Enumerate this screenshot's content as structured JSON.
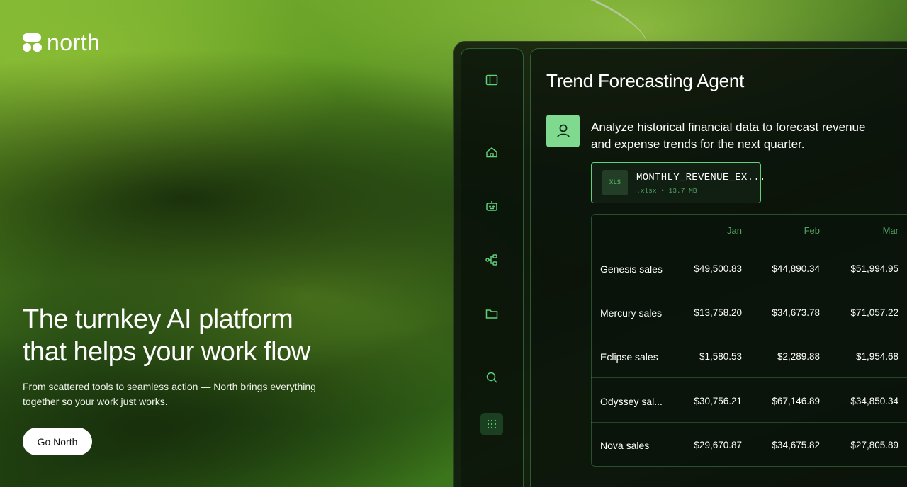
{
  "brand": {
    "name": "north"
  },
  "hero": {
    "headline_line1": "The turnkey AI platform",
    "headline_line2": "that helps your work flow",
    "subtext": "From scattered tools to seamless action — North brings everything together so your work just works.",
    "cta_label": "Go North"
  },
  "sidebar": {
    "icons": [
      "sidebar-toggle-icon",
      "home-icon",
      "bot-icon",
      "workflow-icon",
      "folder-icon",
      "search-icon",
      "apps-grid-icon"
    ]
  },
  "agent": {
    "title": "Trend Forecasting Agent",
    "prompt": "Analyze historical financial data to forecast revenue and expense trends for the next quarter.",
    "file": {
      "badge": "XLS",
      "name": "MONTHLY_REVENUE_EX...",
      "meta": ".xlsx • 13.7 MB"
    }
  },
  "table": {
    "columns": [
      "Jan",
      "Feb",
      "Mar"
    ],
    "rows": [
      {
        "label": "Genesis sales",
        "values": [
          "$49,500.83",
          "$44,890.34",
          "$51,994.95"
        ]
      },
      {
        "label": "Mercury sales",
        "values": [
          "$13,758.20",
          "$34,673.78",
          "$71,057.22"
        ]
      },
      {
        "label": "Eclipse sales",
        "values": [
          "$1,580.53",
          "$2,289.88",
          "$1,954.68"
        ]
      },
      {
        "label": "Odyssey sal...",
        "values": [
          "$30,756.21",
          "$67,146.89",
          "$34,850.34"
        ]
      },
      {
        "label": "Nova sales",
        "values": [
          "$29,670.87",
          "$34,675.82",
          "$27,805.89"
        ]
      }
    ]
  },
  "colors": {
    "accent_green": "#5fd17a",
    "avatar_green": "#7fd98f",
    "muted_green": "#4fa362"
  }
}
